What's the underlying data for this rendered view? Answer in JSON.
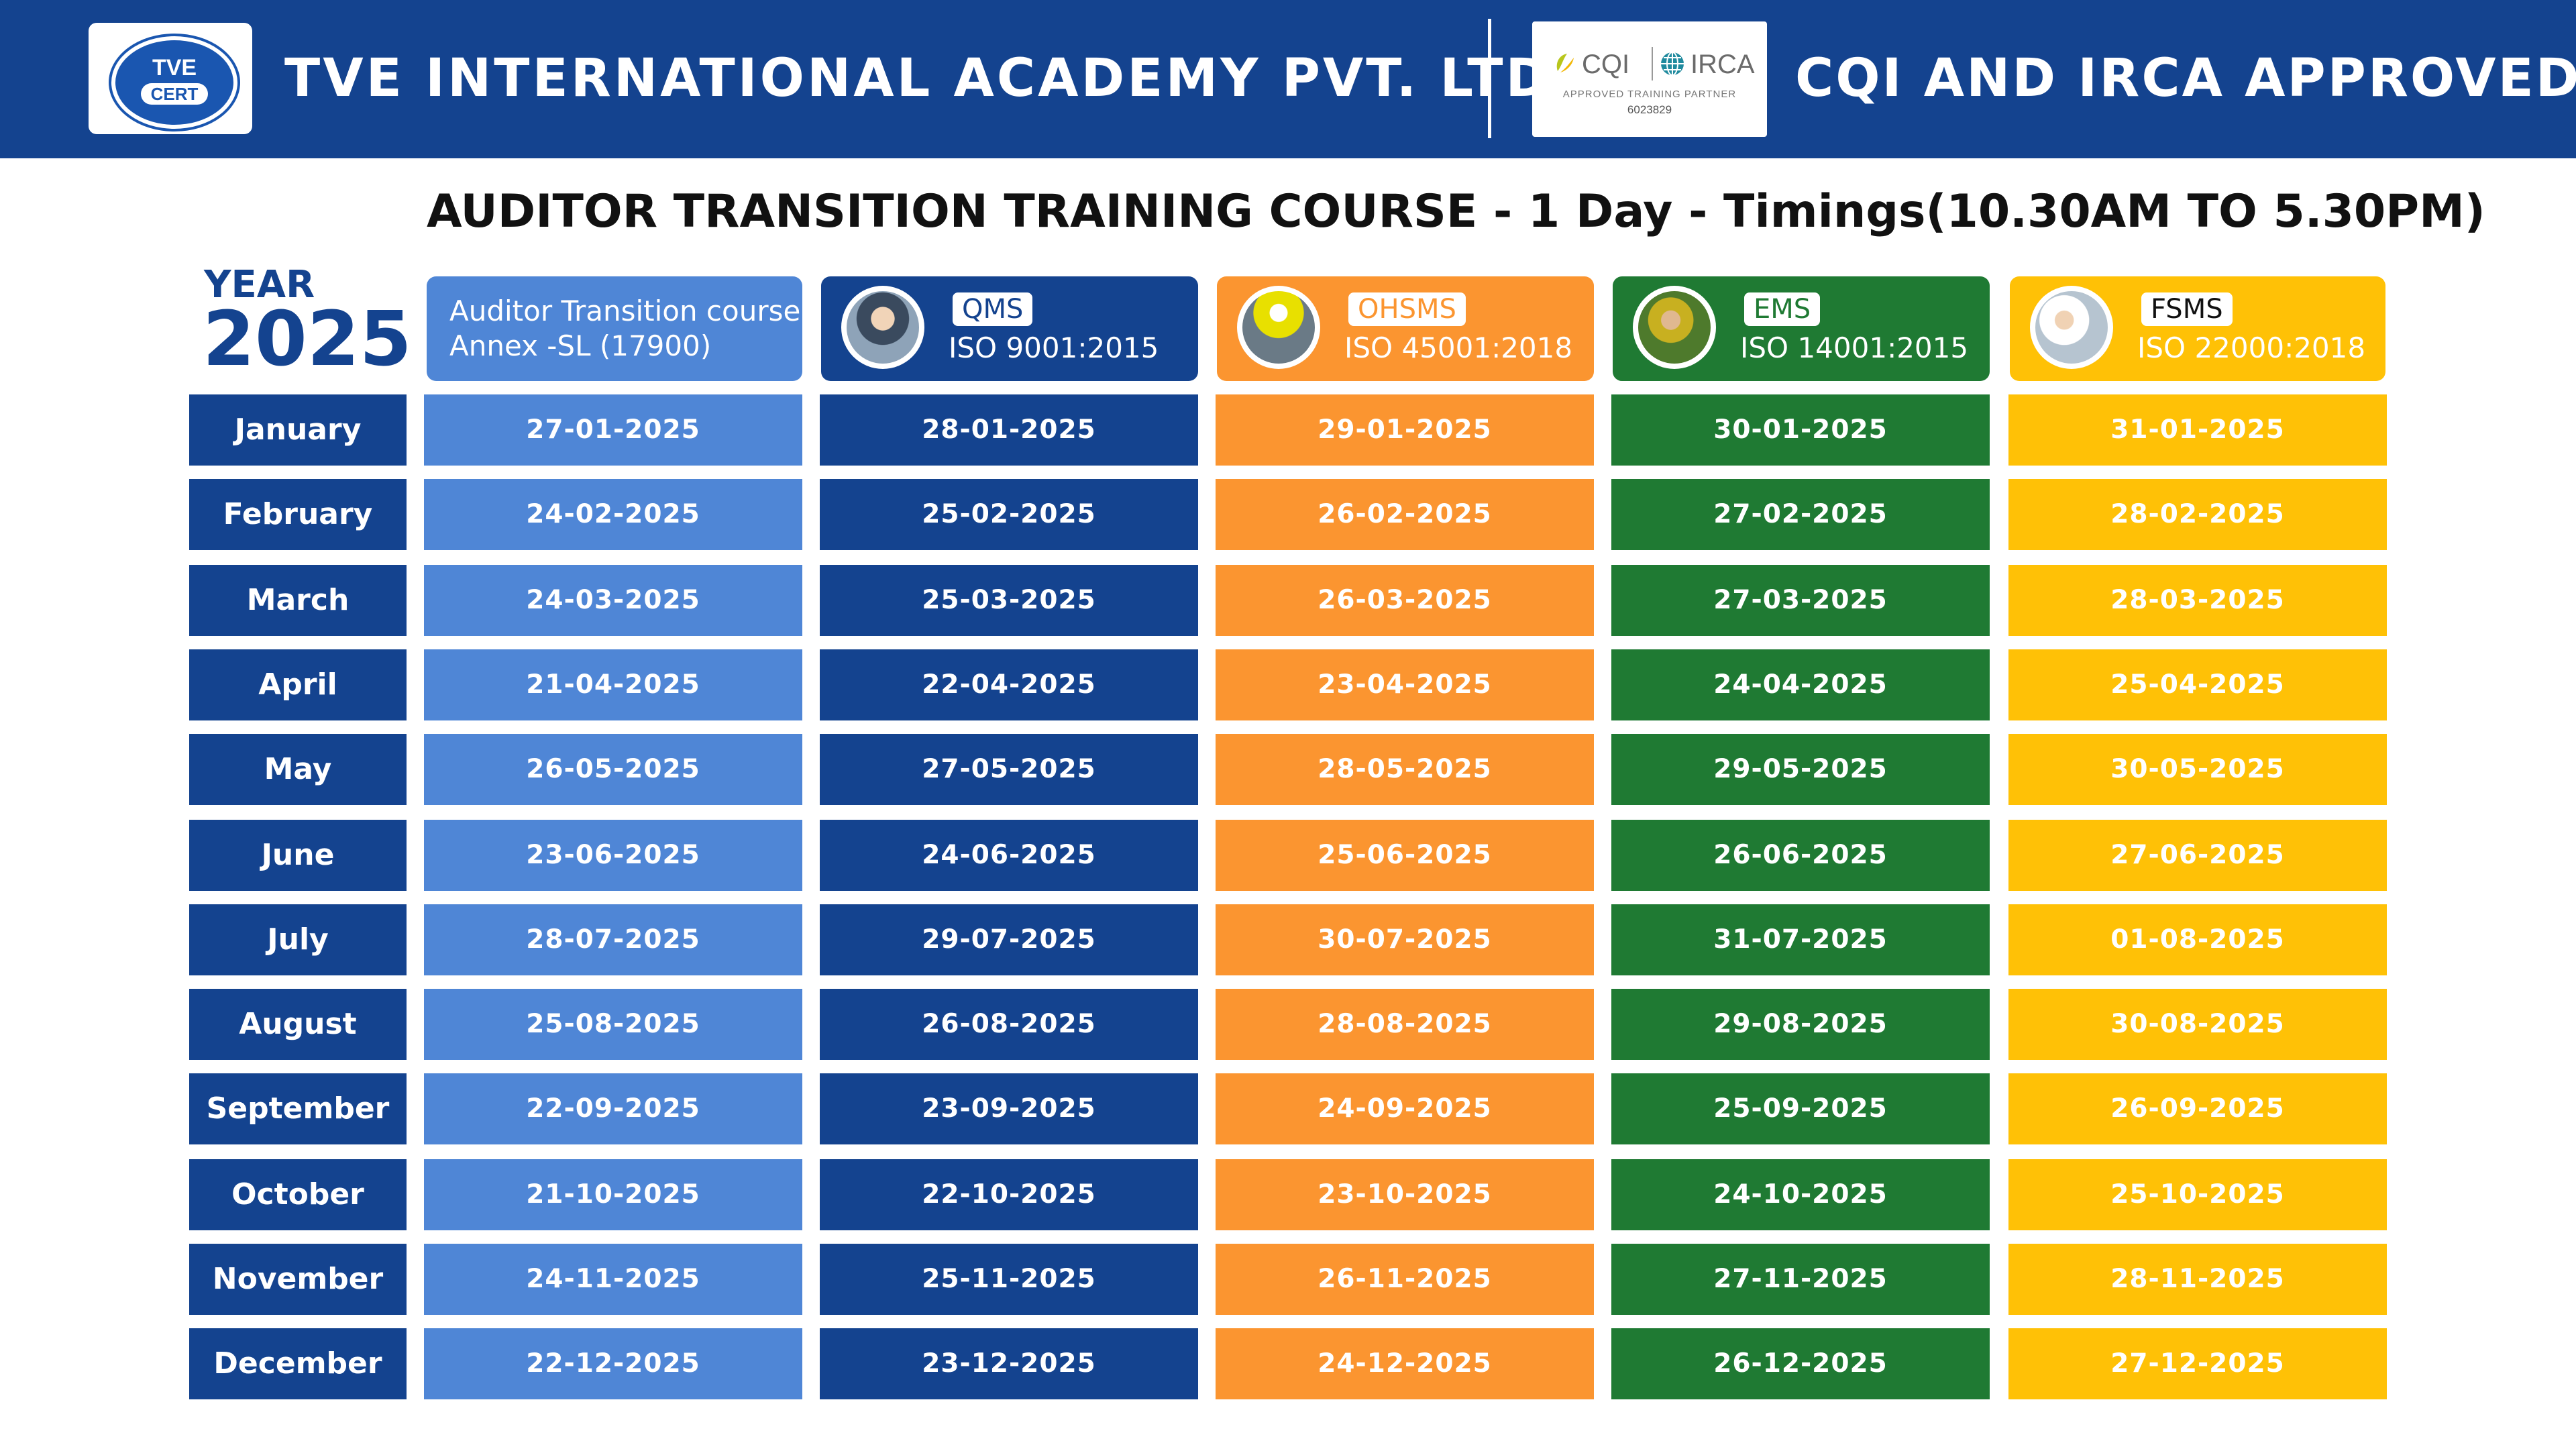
{
  "header": {
    "logo_line1": "TVE",
    "logo_line2": "CERT",
    "company": "TVE INTERNATIONAL ACADEMY PVT. LTD.",
    "cqi_label": "CQI",
    "irca_label": "IRCA",
    "partner_label": "APPROVED TRAINING PARTNER",
    "partner_number": "6023829",
    "approval": "CQI AND IRCA APPROVED"
  },
  "course_title": "AUDITOR TRANSITION TRAINING COURSE - 1 Day - Timings(10.30AM TO 5.30PM)",
  "year": {
    "label": "YEAR",
    "value": "2025"
  },
  "columns": [
    {
      "line1": "Auditor Transition course",
      "line2": "Annex -SL (17900)",
      "color": "#4f86d6"
    },
    {
      "tag": "QMS",
      "standard": "ISO 9001:2015",
      "icon": "qms-photo",
      "color": "#14438f"
    },
    {
      "tag": "OHSMS",
      "standard": "ISO 45001:2018",
      "icon": "ohsms-photo",
      "color": "#fb9530"
    },
    {
      "tag": "EMS",
      "standard": "ISO 14001:2015",
      "icon": "ems-photo",
      "color": "#1f7a33"
    },
    {
      "tag": "FSMS",
      "standard": "ISO 22000:2018",
      "icon": "fsms-photo",
      "color": "#ffc106"
    }
  ],
  "schedule": [
    {
      "month": "January",
      "dates": [
        "27-01-2025",
        "28-01-2025",
        "29-01-2025",
        "30-01-2025",
        "31-01-2025"
      ]
    },
    {
      "month": "February",
      "dates": [
        "24-02-2025",
        "25-02-2025",
        "26-02-2025",
        "27-02-2025",
        "28-02-2025"
      ]
    },
    {
      "month": "March",
      "dates": [
        "24-03-2025",
        "25-03-2025",
        "26-03-2025",
        "27-03-2025",
        "28-03-2025"
      ]
    },
    {
      "month": "April",
      "dates": [
        "21-04-2025",
        "22-04-2025",
        "23-04-2025",
        "24-04-2025",
        "25-04-2025"
      ]
    },
    {
      "month": "May",
      "dates": [
        "26-05-2025",
        "27-05-2025",
        "28-05-2025",
        "29-05-2025",
        "30-05-2025"
      ]
    },
    {
      "month": "June",
      "dates": [
        "23-06-2025",
        "24-06-2025",
        "25-06-2025",
        "26-06-2025",
        "27-06-2025"
      ]
    },
    {
      "month": "July",
      "dates": [
        "28-07-2025",
        "29-07-2025",
        "30-07-2025",
        "31-07-2025",
        "01-08-2025"
      ]
    },
    {
      "month": "August",
      "dates": [
        "25-08-2025",
        "26-08-2025",
        "28-08-2025",
        "29-08-2025",
        "30-08-2025"
      ]
    },
    {
      "month": "September",
      "dates": [
        "22-09-2025",
        "23-09-2025",
        "24-09-2025",
        "25-09-2025",
        "26-09-2025"
      ]
    },
    {
      "month": "October",
      "dates": [
        "21-10-2025",
        "22-10-2025",
        "23-10-2025",
        "24-10-2025",
        "25-10-2025"
      ]
    },
    {
      "month": "November",
      "dates": [
        "24-11-2025",
        "25-11-2025",
        "26-11-2025",
        "27-11-2025",
        "28-11-2025"
      ]
    },
    {
      "month": "December",
      "dates": [
        "22-12-2025",
        "23-12-2025",
        "24-12-2025",
        "26-12-2025",
        "27-12-2025"
      ]
    }
  ]
}
